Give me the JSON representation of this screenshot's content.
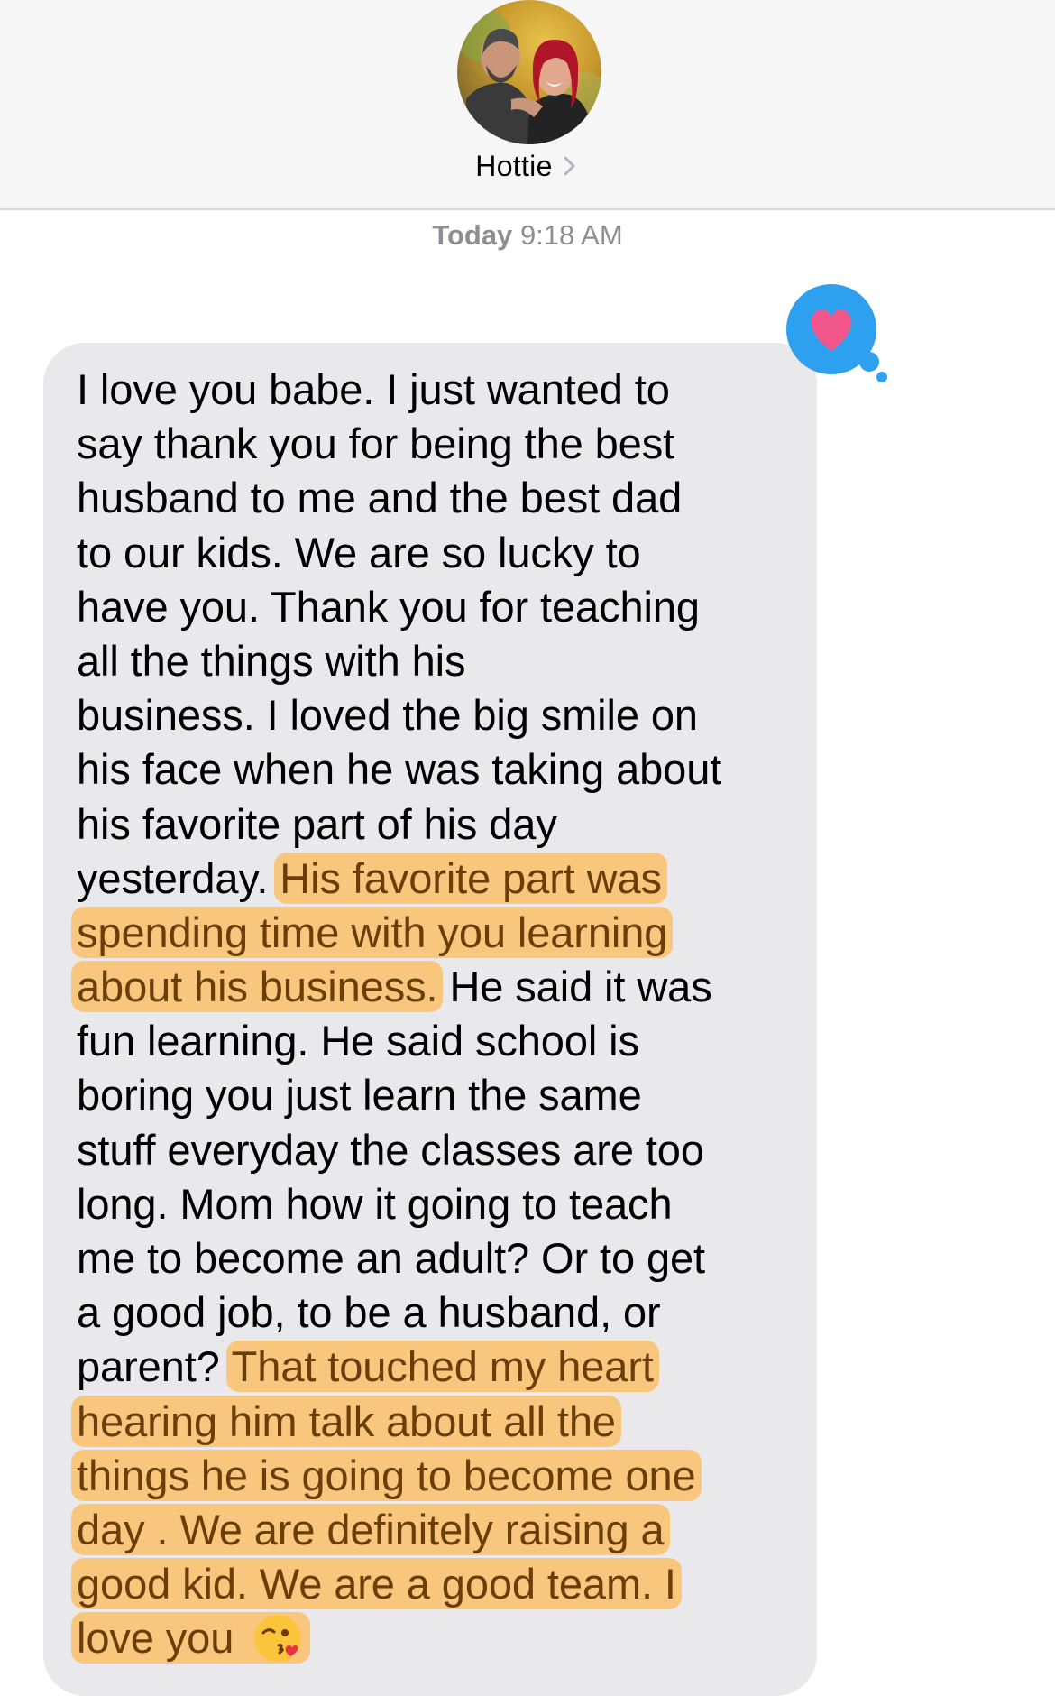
{
  "conversation": {
    "contact_name": "Hottie",
    "timestamp_day": "Today",
    "timestamp_time": "9:18 AM"
  },
  "colors": {
    "bubble_gray": "#e9e9eb",
    "highlight": "#f8c67d",
    "tapback_blue": "#2ea0f0",
    "heart_pink": "#f2578c"
  },
  "icons": {
    "avatar": "contact-photo",
    "chevron": "chevron-right-icon",
    "tapback": "heart-tapback-icon",
    "emoji": "face-blowing-a-kiss-emoji"
  },
  "message": {
    "lines": [
      [
        {
          "t": "I love you babe. I just wanted to"
        }
      ],
      [
        {
          "t": "say thank you for being the best"
        }
      ],
      [
        {
          "t": "husband to me and the best dad"
        }
      ],
      [
        {
          "t": "to our kids. We are so lucky to"
        }
      ],
      [
        {
          "t": "have you. Thank you for teaching"
        }
      ],
      [
        {
          "t": "all the things with his"
        }
      ],
      [
        {
          "t": "business. I loved the big smile on"
        }
      ],
      [
        {
          "t": "his face when he was taking about"
        }
      ],
      [
        {
          "t": "his favorite part of his day"
        }
      ],
      [
        {
          "t": "yesterday. "
        },
        {
          "t": "His favorite part was",
          "hl": true
        }
      ],
      [
        {
          "t": "spending time with you learning",
          "hl": true
        }
      ],
      [
        {
          "t": "about his business.",
          "hl": true
        },
        {
          "t": " He said it was"
        }
      ],
      [
        {
          "t": "fun learning. He said school is"
        }
      ],
      [
        {
          "t": "boring you just learn the same"
        }
      ],
      [
        {
          "t": "stuff everyday the classes are too"
        }
      ],
      [
        {
          "t": "long. Mom how it going to teach"
        }
      ],
      [
        {
          "t": "me to become an adult? Or to get"
        }
      ],
      [
        {
          "t": "a good job, to be a husband, or"
        }
      ],
      [
        {
          "t": "parent? "
        },
        {
          "t": "That touched my heart",
          "hl": true
        }
      ],
      [
        {
          "t": "hearing him talk about all the",
          "hl": true
        }
      ],
      [
        {
          "t": "things he is going to become one",
          "hl": true
        }
      ],
      [
        {
          "t": "day . We are definitely raising a",
          "hl": true
        }
      ],
      [
        {
          "t": "good kid. We are a good team. I",
          "hl": true
        }
      ],
      [
        {
          "t": "love you",
          "hl": true,
          "emoji": true
        }
      ]
    ]
  }
}
